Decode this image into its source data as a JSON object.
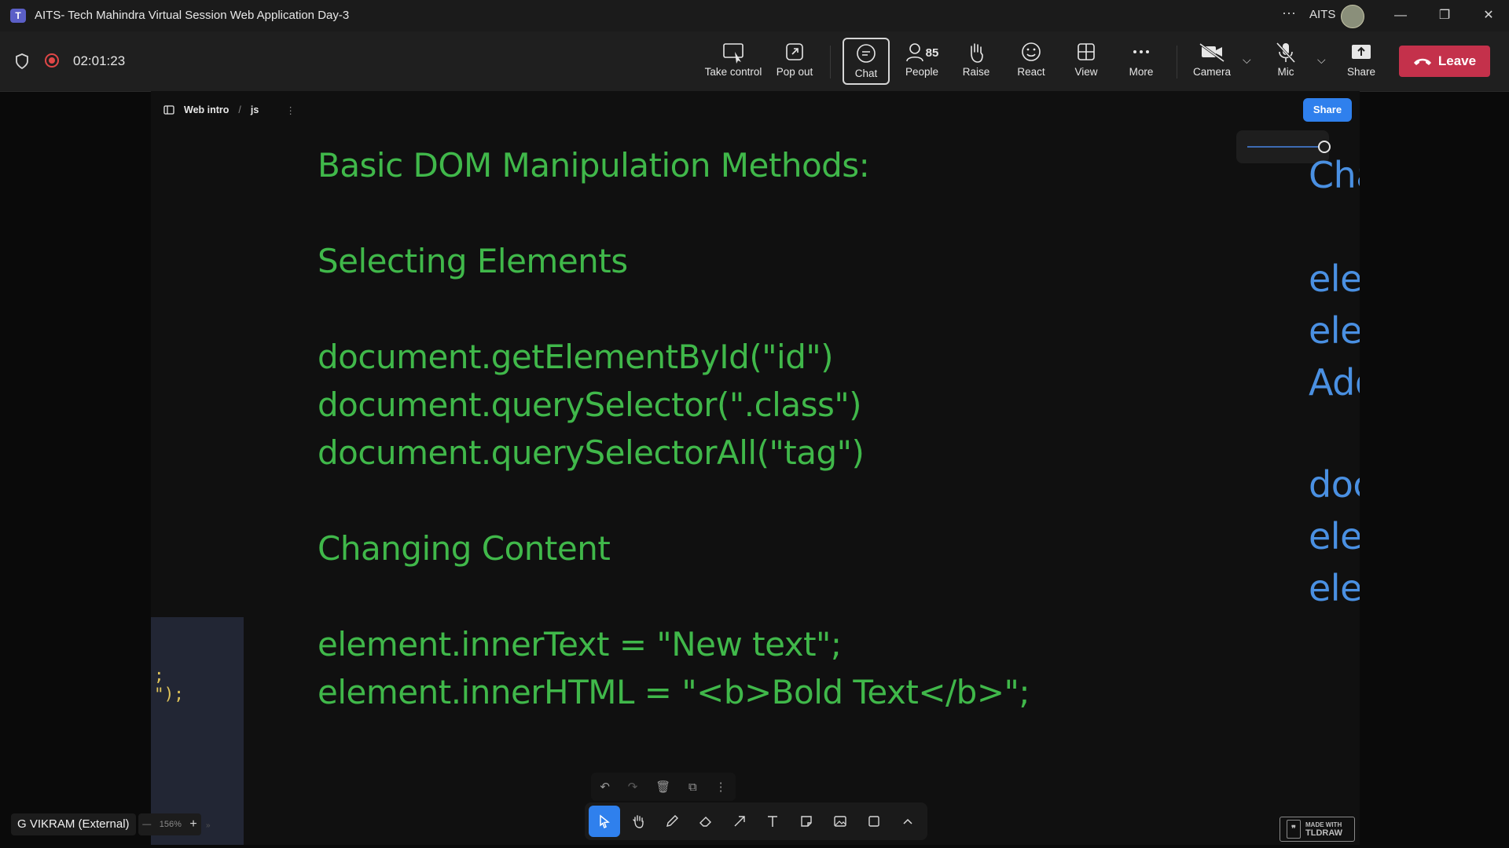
{
  "window": {
    "title": "AITS- Tech Mahindra Virtual Session Web Application Day-3",
    "org": "AITS",
    "app_icon": "teams-icon"
  },
  "meeting": {
    "timer": "02:01:23",
    "controls": {
      "take_control": "Take control",
      "pop_out": "Pop out",
      "chat": "Chat",
      "people": "People",
      "people_count": "85",
      "raise": "Raise",
      "react": "React",
      "view": "View",
      "more": "More",
      "camera": "Camera",
      "mic": "Mic",
      "share": "Share",
      "leave": "Leave"
    },
    "colors": {
      "leave": "#c4314b",
      "recording": "#e04747"
    }
  },
  "canvas": {
    "breadcrumb": [
      "Web intro",
      "js"
    ],
    "share_label": "Share",
    "colors": {
      "green_text": "#40b84a",
      "blue_text": "#4a90e2",
      "accent": "#2f80ed"
    }
  },
  "slide": {
    "heading": "Basic DOM Manipulation Methods:",
    "selecting_title": "Selecting Elements",
    "selecting_lines": [
      "document.getElementById(\"id\")",
      "document.querySelector(\".class\")",
      "document.querySelectorAll(\"tag\")"
    ],
    "content_title": "Changing Content",
    "content_lines": [
      "element.innerText = \"New text\";",
      "element.innerHTML = \"<b>Bold Text</b>\";"
    ],
    "right_lines": [
      "Changing S",
      "element.sty",
      "element.sty",
      "Adding & Re",
      "document.c",
      "element.ap",
      "element.rer"
    ]
  },
  "side_snippet": [
    ";",
    "\");"
  ],
  "participant": {
    "name": "G VIKRAM (External)"
  },
  "zoom": {
    "level": "156%"
  },
  "badge": {
    "line1": "MADE WITH",
    "line2": "TLDRAW"
  }
}
